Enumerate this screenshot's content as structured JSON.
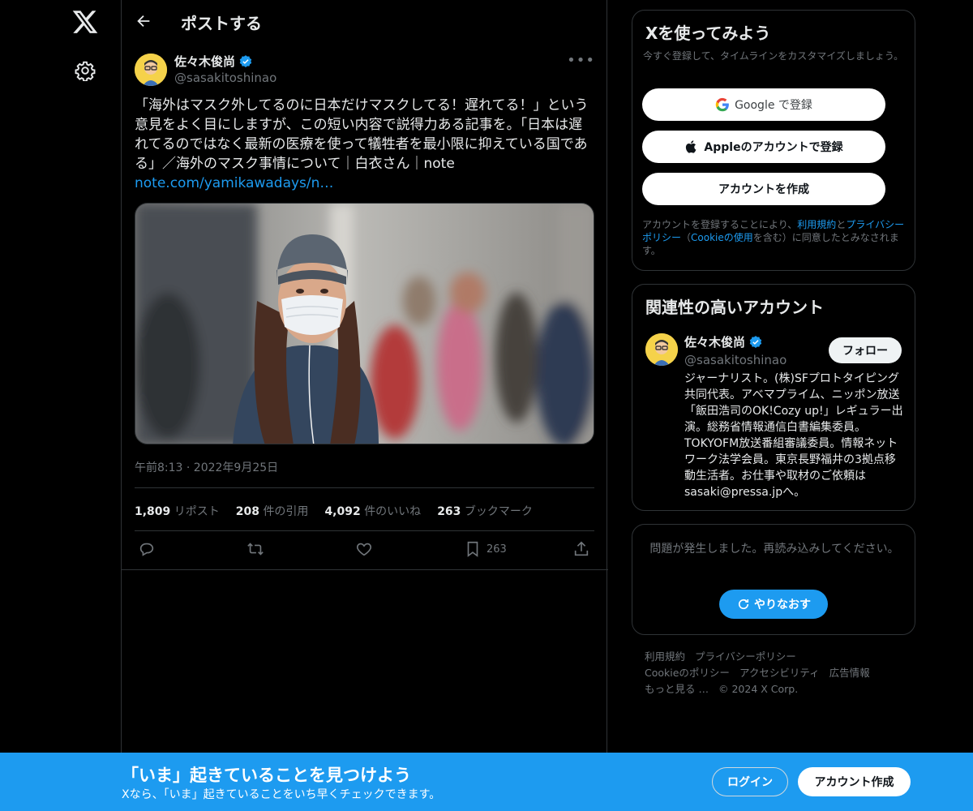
{
  "colors": {
    "accent": "#1d9bf0",
    "background": "#000000",
    "text": "#e7e9ea",
    "muted": "#71767b",
    "border": "#2f3336"
  },
  "header": {
    "title": "ポストする"
  },
  "post": {
    "author_name": "佐々木俊尚",
    "author_handle": "@sasakitoshinao",
    "text": "「海外はマスク外してるのに日本だけマスクしてる！遅れてる！」という\n意見をよく目にしますが、この短い内容で説得力ある記事を。「日本は遅\nれてるのではなく最新の医療を使って犠牲者を最小限に抑えている国であ\nる」／海外のマスク事情について｜白衣さん｜note",
    "link": "note.com/yamikawadays/n…",
    "timestamp": "午前8:13 · 2022年9月25日",
    "stats": {
      "reposts_count": "1,809",
      "reposts_label": "リポスト",
      "quotes_count": "208",
      "quotes_label": "件の引用",
      "likes_count": "4,092",
      "likes_label": "件のいいね",
      "bookmarks_count": "263",
      "bookmarks_label": "ブックマーク"
    },
    "bookmark_action_count": "263"
  },
  "signup": {
    "title": "Xを使ってみよう",
    "subtitle": "今すぐ登録して、タイムラインをカスタマイズしましょう。",
    "google_label": "Google で登録",
    "apple_label": "Appleのアカウントで登録",
    "create_label": "アカウントを作成",
    "legal_prefix": "アカウントを登録することにより、",
    "legal_terms": "利用規約",
    "legal_and": "と",
    "legal_privacy": "プライバシーポリシー",
    "legal_open": "（",
    "legal_cookie": "Cookieの使用",
    "legal_suffix": "を含む）に同意したとみなされます。"
  },
  "related": {
    "title": "関連性の高いアカウント",
    "name": "佐々木俊尚",
    "handle": "@sasakitoshinao",
    "follow_label": "フォロー",
    "bio": "ジャーナリスト。(株)SFプロトタイピング共同代表。アベマプライム、ニッポン放送「飯田浩司のOK!Cozy up!」レギュラー出演。総務省情報通信白書編集委員。TOKYOFM放送番組審議委員。情報ネットワーク法学会員。東京長野福井の3拠点移動生活者。お仕事や取材のご依頼はsasaki@pressa.jpへ。"
  },
  "error": {
    "message": "問題が発生しました。再読み込みしてください。",
    "retry_label": "やりなおす"
  },
  "footer": {
    "terms": "利用規約",
    "privacy": "プライバシーポリシー",
    "cookie": "Cookieのポリシー",
    "accessibility": "アクセシビリティ",
    "ads": "広告情報",
    "more": "もっと見る …",
    "copyright": "© 2024 X Corp."
  },
  "banner": {
    "headline": "「いま」起きていることを見つけよう",
    "subline": "Xなら、「いま」起きていることをいち早くチェックできます。",
    "login_label": "ログイン",
    "create_label": "アカウント作成"
  }
}
